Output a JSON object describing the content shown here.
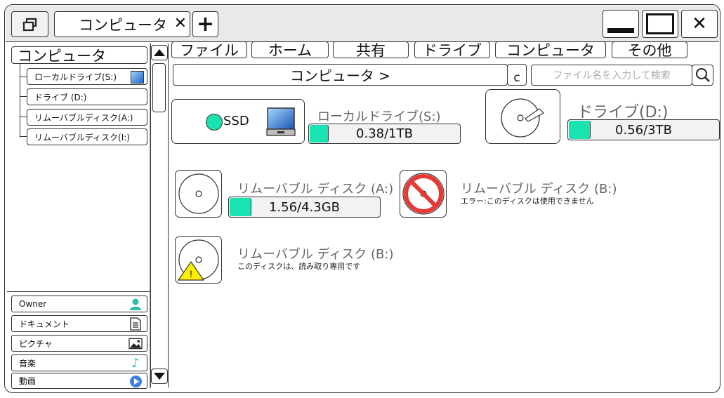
{
  "titlebar": {
    "tab_title": "コンピュータ",
    "close_tab_symbol": "✕",
    "new_tab_symbol": "+",
    "minimize_symbol": "",
    "maximize_symbol": "",
    "close_symbol": "✕"
  },
  "menu": {
    "file": "ファイル",
    "home": "ホーム",
    "share": "共有",
    "drive": "ドライブ",
    "computer": "コンピュータ",
    "other": "その他"
  },
  "address": {
    "path": "コンピュータ >",
    "refresh_symbol": "c",
    "search_placeholder": "ファイル名を入力して検索"
  },
  "sidebar": {
    "root": "コンピュータ",
    "tree": [
      {
        "label": "ローカルドライブ(S:)"
      },
      {
        "label": "ドライブ (D:)"
      },
      {
        "label": "リムーバブルディスク(A:)"
      },
      {
        "label": "リムーバブルディスク(I:)"
      }
    ],
    "libraries": [
      {
        "label": "Owner",
        "icon": "user-icon"
      },
      {
        "label": "ドキュメント",
        "icon": "document-icon"
      },
      {
        "label": "ピクチャ",
        "icon": "picture-icon"
      },
      {
        "label": "音楽",
        "icon": "music-icon"
      },
      {
        "label": "動画",
        "icon": "video-icon"
      }
    ]
  },
  "drives": {
    "local_s": {
      "badge": "SSD",
      "label": "ローカルドライブ(S:)",
      "usage": "0.38/1TB",
      "fill": 0.12
    },
    "drive_d": {
      "label": "ドライブ(D:)",
      "usage": "0.56/3TB",
      "fill": 0.14
    },
    "removable_a": {
      "label": "リムーバブル ディスク (A:)",
      "usage": "1.56/4.3GB",
      "fill": 0.14
    },
    "removable_b_error": {
      "label": "リムーバブル ディスク (B:)",
      "note": "エラー:このディスクは使用できません"
    },
    "removable_b_readonly": {
      "label": "リムーバブル ディスク (B:)",
      "note": "このディスクは、読み取り専用です"
    }
  },
  "colors": {
    "accent": "#19e3b1",
    "warning": "#ffee00",
    "error": "#e53935"
  }
}
